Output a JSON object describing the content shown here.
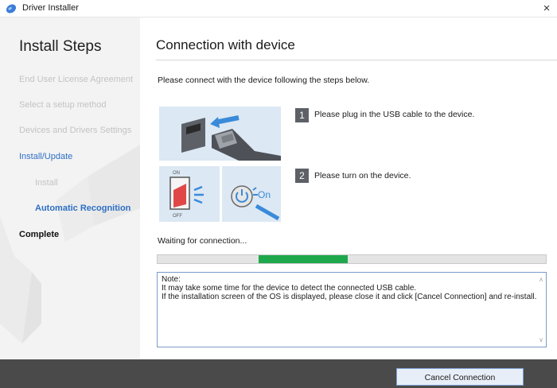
{
  "window": {
    "title": "Driver Installer",
    "icon": "installer-disc-icon",
    "close_glyph": "×"
  },
  "sidebar": {
    "heading": "Install Steps",
    "steps": [
      {
        "label": "End User License Agreement",
        "state": "inactive"
      },
      {
        "label": "Select a setup method",
        "state": "inactive"
      },
      {
        "label": "Devices and Drivers Settings",
        "state": "inactive"
      },
      {
        "label": "Install/Update",
        "state": "active"
      },
      {
        "label": "Install",
        "state": "inactive-sub"
      },
      {
        "label": "Automatic Recognition",
        "state": "current-sub"
      },
      {
        "label": "Complete",
        "state": "done"
      }
    ]
  },
  "main": {
    "title": "Connection with device",
    "intro": "Please connect with the device following the steps below.",
    "instructions": [
      {
        "number": "1",
        "text": "Please plug in the USB cable to the device.",
        "illustration": "usb-plug-illustration"
      },
      {
        "number": "2",
        "text": "Please turn on the device.",
        "illustration": "power-switch-illustration",
        "power_label": "On",
        "switch_on": "ON",
        "switch_off": "OFF"
      }
    ],
    "status": "Waiting for connection...",
    "progress": {
      "indeterminate": true,
      "segment_start": 0.26,
      "segment_end": 0.49,
      "color": "#1ea84b"
    },
    "note": {
      "lines": [
        "Note:",
        "It may take some time for the device to detect the connected USB cable.",
        "If the installation screen of the OS is displayed, please close it and click [Cancel Connection] and re-install."
      ]
    }
  },
  "footer": {
    "cancel_label": "Cancel Connection"
  },
  "colors": {
    "accent": "#2d6fc4",
    "footer": "#4a4a4a",
    "progress": "#1ea84b"
  }
}
